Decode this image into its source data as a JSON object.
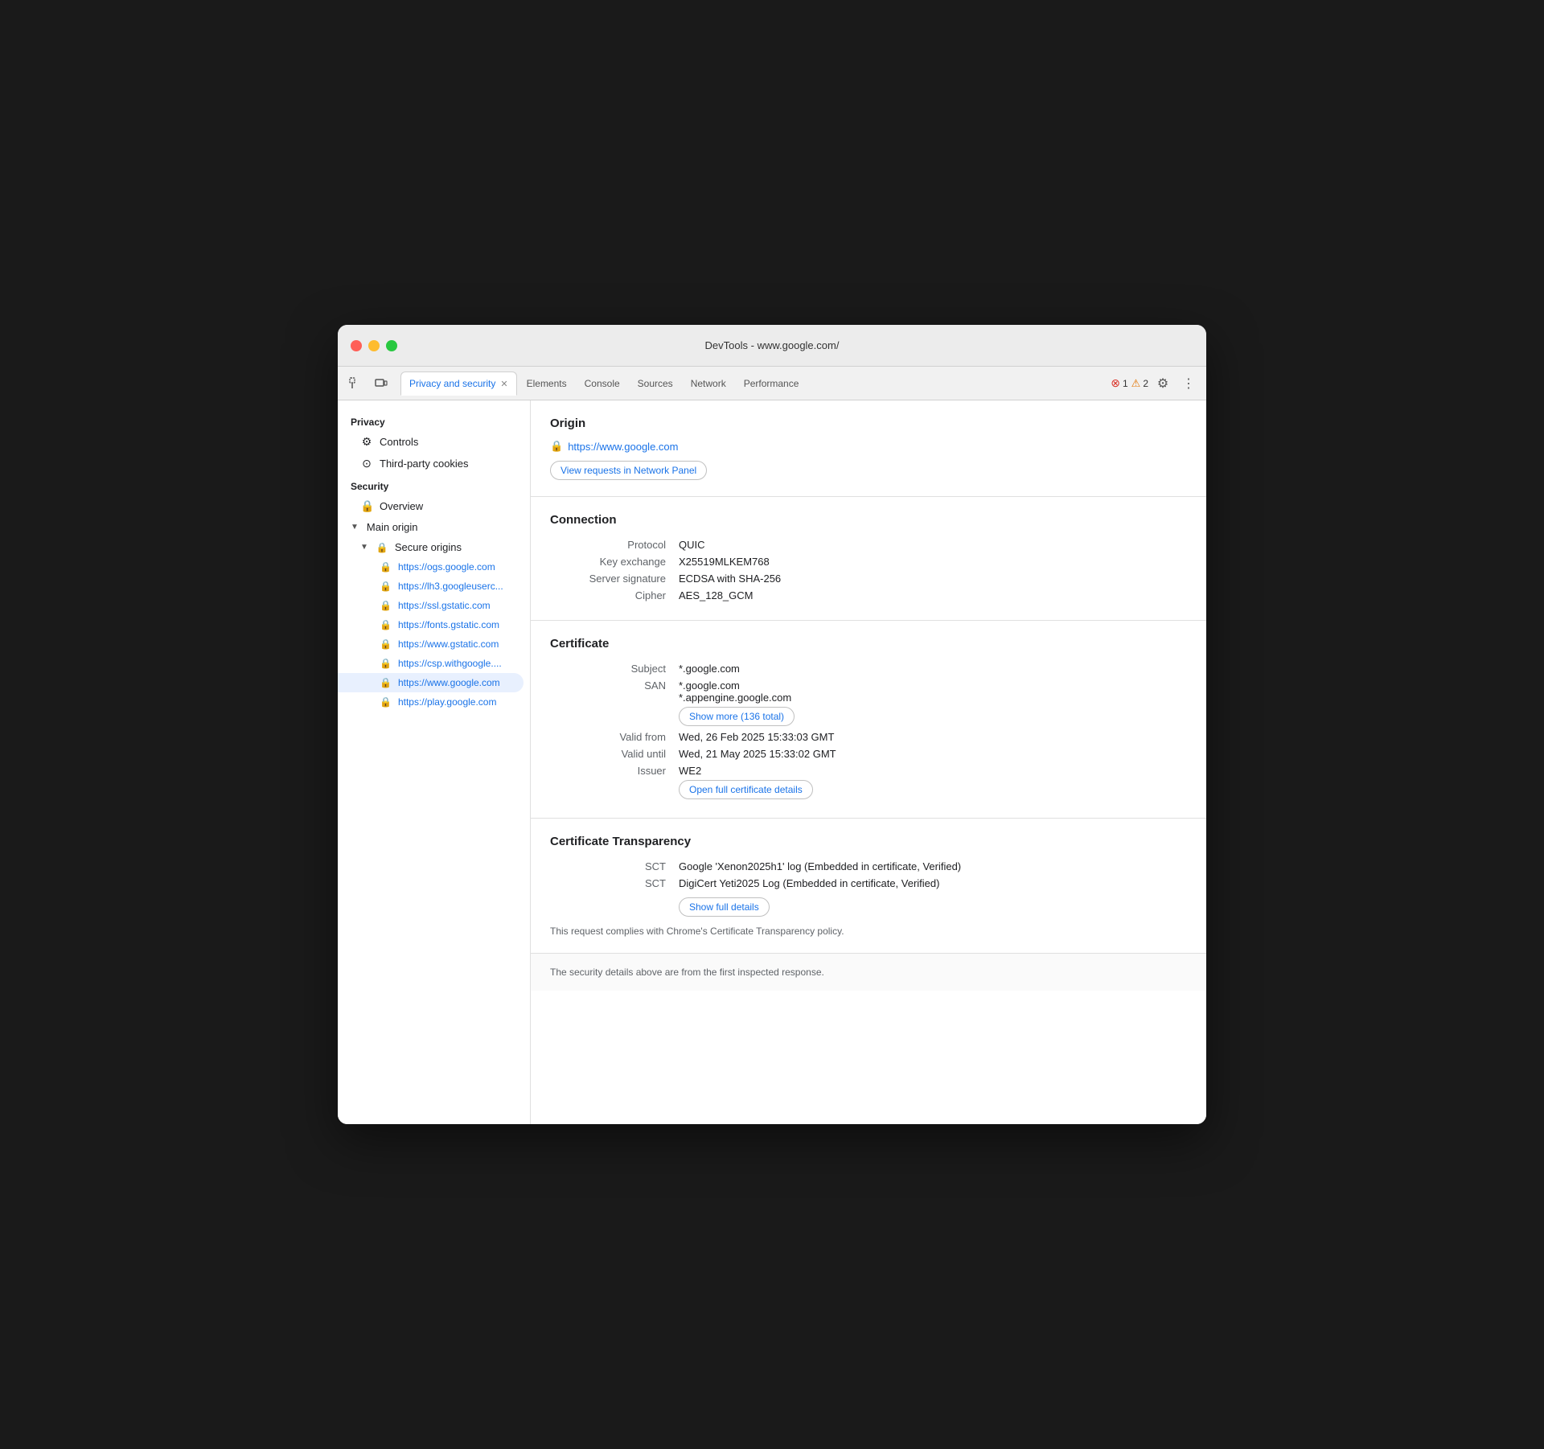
{
  "titlebar": {
    "title": "DevTools - www.google.com/"
  },
  "tabs": [
    {
      "label": "Privacy and security",
      "active": true,
      "closeable": true
    },
    {
      "label": "Elements",
      "active": false,
      "closeable": false
    },
    {
      "label": "Console",
      "active": false,
      "closeable": false
    },
    {
      "label": "Sources",
      "active": false,
      "closeable": false
    },
    {
      "label": "Network",
      "active": false,
      "closeable": false
    },
    {
      "label": "Performance",
      "active": false,
      "closeable": false
    }
  ],
  "errors": {
    "error_count": "1",
    "warning_count": "2"
  },
  "sidebar": {
    "privacy_label": "Privacy",
    "controls_label": "Controls",
    "third_party_cookies_label": "Third-party cookies",
    "security_label": "Security",
    "overview_label": "Overview",
    "main_origin_label": "Main origin",
    "secure_origins_label": "Secure origins",
    "origins": [
      "https://ogs.google.com",
      "https://lh3.googleuserc...",
      "https://ssl.gstatic.com",
      "https://fonts.gstatic.com",
      "https://www.gstatic.com",
      "https://csp.withgoogle....",
      "https://www.google.com",
      "https://play.google.com"
    ],
    "active_origin_index": 6
  },
  "origin": {
    "section_title": "Origin",
    "url": "https://www.google.com",
    "view_requests_btn": "View requests in Network Panel"
  },
  "connection": {
    "section_title": "Connection",
    "protocol_label": "Protocol",
    "protocol_value": "QUIC",
    "key_exchange_label": "Key exchange",
    "key_exchange_value": "X25519MLKEM768",
    "server_signature_label": "Server signature",
    "server_signature_value": "ECDSA with SHA-256",
    "cipher_label": "Cipher",
    "cipher_value": "AES_128_GCM"
  },
  "certificate": {
    "section_title": "Certificate",
    "subject_label": "Subject",
    "subject_value": "*.google.com",
    "san_label": "SAN",
    "san_value1": "*.google.com",
    "san_value2": "*.appengine.google.com",
    "show_more_btn": "Show more (136 total)",
    "valid_from_label": "Valid from",
    "valid_from_value": "Wed, 26 Feb 2025 15:33:03 GMT",
    "valid_until_label": "Valid until",
    "valid_until_value": "Wed, 21 May 2025 15:33:02 GMT",
    "issuer_label": "Issuer",
    "issuer_value": "WE2",
    "open_cert_btn": "Open full certificate details"
  },
  "transparency": {
    "section_title": "Certificate Transparency",
    "sct1_label": "SCT",
    "sct1_value": "Google 'Xenon2025h1' log (Embedded in certificate, Verified)",
    "sct2_label": "SCT",
    "sct2_value": "DigiCert Yeti2025 Log (Embedded in certificate, Verified)",
    "show_full_btn": "Show full details",
    "compliance_text": "This request complies with Chrome's Certificate Transparency policy."
  },
  "footer": {
    "note": "The security details above are from the first inspected response."
  }
}
